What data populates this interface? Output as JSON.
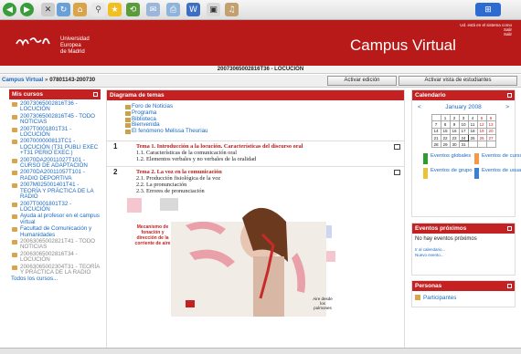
{
  "header": {
    "uni_lines": [
      "Universidad",
      "Europea",
      "de Madrid"
    ],
    "login_line1": "Ud. está en el sistema como",
    "login_line2": "Salir",
    "login_line3": "Salir",
    "site_name": "Campus Virtual"
  },
  "course_code": "20073065002816T36 - LOCUCIÓN",
  "nav": {
    "crumb_site": "Campus Virtual",
    "crumb_sep": "»",
    "crumb_course": "07801143-200730",
    "edit_button": "Activar edición",
    "student_button": "Activar vista de estudiantes"
  },
  "my_courses": {
    "title": "Mis cursos",
    "items": [
      {
        "text": "20073065002816T36 - LOCUCIÓN",
        "dim": false
      },
      {
        "text": "20073065002816T45 - TODO NOTICIAS",
        "dim": false
      },
      {
        "text": "2007T0001801T31 - LOCUCIÓN",
        "dim": false
      },
      {
        "text": "2007000000813TC1 - LOCUCIÓN (T31 PUBLI EXEC +T31 PERIO EXEC.)",
        "dim": false
      },
      {
        "text": "20070DA20011027T101 - CURSO DE ADAPTACIÓN",
        "dim": false
      },
      {
        "text": "20070DA20011057T101 - RADIO DEPORTIVA",
        "dim": false
      },
      {
        "text": "2007M025001401T41 - TEORÍA Y PRÁCTICA DE LA RADIO",
        "dim": false
      },
      {
        "text": "2007T0001801T32 - LOCUCIÓN",
        "dim": false
      },
      {
        "text": "Ayuda al profesor en el campus virtual",
        "dim": false
      },
      {
        "text": "Facultad de Comunicación y Humanidades",
        "dim": false
      },
      {
        "text": "20063065002821T41 - TODO NOTICIAS",
        "dim": true
      },
      {
        "text": "20063065002816T34 - LOCUCIÓN",
        "dim": true
      },
      {
        "text": "20063065002304T31 - TEORÍA Y PRÁCTICA DE LA RADIO",
        "dim": true
      }
    ],
    "all_courses": "Todos los cursos..."
  },
  "topics": {
    "title": "Diagrama de temas",
    "links": [
      "Foro de Noticias",
      "Programa",
      "Biblioteca",
      "Bienvenida",
      "El fenómeno Melissa Theuriau"
    ],
    "sections": [
      {
        "num": "1",
        "title": "Tema 1. Introducción a la locución. Características del discurso oral",
        "items": [
          "1.1. Características de la comunicación oral",
          "1.2. Elementos verbales y no verbales de la oralidad"
        ]
      },
      {
        "num": "2",
        "title": "Tema 2. La voz en la comunicación",
        "items": [
          "2.1. Producción fisiológica de la voz",
          "2.2. La pronunciación",
          "2.3. Errores de pronunciación"
        ]
      }
    ],
    "image_caption_left": [
      "Mecanismo de",
      "fonación y",
      "dirección de la",
      "corriente de aire"
    ],
    "image_caption_right": [
      "Aire desde",
      "los",
      "pulmones"
    ]
  },
  "calendar": {
    "title": "Calendario",
    "month": "January 2008",
    "prev": "<",
    "next": ">",
    "weeks": [
      [
        "",
        "1",
        "2",
        "3",
        "4",
        "5",
        "6"
      ],
      [
        "7",
        "8",
        "9",
        "10",
        "11",
        "12",
        "13"
      ],
      [
        "14",
        "15",
        "16",
        "17",
        "18",
        "19",
        "20"
      ],
      [
        "21",
        "22",
        "23",
        "24",
        "25",
        "26",
        "27"
      ],
      [
        "28",
        "29",
        "30",
        "31",
        "",
        "",
        ""
      ]
    ],
    "today": "24",
    "legend": [
      {
        "label": "Eventos globales",
        "color": "#2e9b2e"
      },
      {
        "label": "Eventos de curso",
        "color": "#f29a4a"
      },
      {
        "label": "Eventos de grupo",
        "color": "#e8c23a"
      },
      {
        "label": "Eventos de usuario",
        "color": "#3c7fd6"
      }
    ]
  },
  "events": {
    "title": "Eventos próximos",
    "none": "No hay eventos próximos",
    "link1": "Ir al calendario...",
    "link2": "Nuevo evento..."
  },
  "people": {
    "title": "Personas",
    "participants": "Participantes"
  },
  "colors": {
    "brand": "#b81a1a",
    "link": "#1a69c4"
  }
}
